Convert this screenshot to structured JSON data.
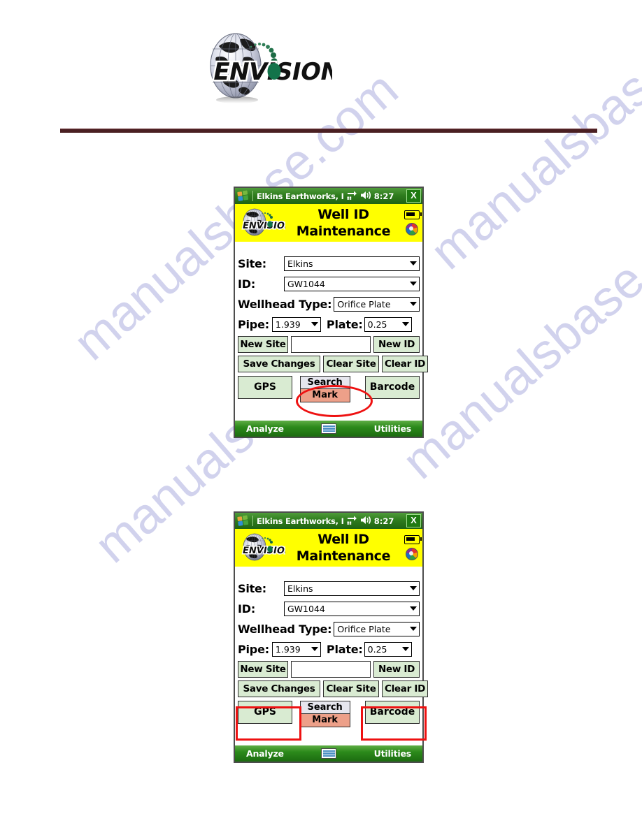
{
  "document": {
    "logo_text": "ENVISION",
    "logo_alt": "envision-globe-logo"
  },
  "screenshots": [
    {
      "id": "screenshot-top",
      "titlebar": {
        "start_icon": "windows-logo-icon",
        "app_title": "Elkins Earthworks, I",
        "network_icon": "network-connectivity-icon",
        "speaker_icon": "speaker-icon",
        "time": "8:27",
        "close_label": "X"
      },
      "header": {
        "brand": "ENVISION",
        "title_line1": "Well ID",
        "title_line2": "Maintenance",
        "battery_icon": "battery-icon",
        "wheel_icon": "color-wheel-icon"
      },
      "form": {
        "site_label": "Site:",
        "site_value": "Elkins",
        "id_label": "ID:",
        "id_value": "GW1044",
        "wellhead_label": "Wellhead Type:",
        "wellhead_value": "Orifice Plate",
        "pipe_label": "Pipe:",
        "pipe_value": "1.939",
        "plate_label": "Plate:",
        "plate_value": "0.25",
        "new_entry_value": ""
      },
      "buttons": {
        "new_site": "New Site",
        "new_id": "New ID",
        "save_changes": "Save Changes",
        "clear_site": "Clear Site",
        "clear_id": "Clear ID",
        "gps": "GPS",
        "search": "Search",
        "mark": "Mark",
        "barcode": "Barcode"
      },
      "bottombar": {
        "left": "Analyze",
        "keyboard_icon": "keyboard-icon",
        "right": "Utilities"
      },
      "annotation": {
        "type": "oval",
        "target": "mark-button",
        "color": "#ee1111"
      }
    },
    {
      "id": "screenshot-bottom",
      "titlebar": {
        "start_icon": "windows-logo-icon",
        "app_title": "Elkins Earthworks, I",
        "network_icon": "network-connectivity-icon",
        "speaker_icon": "speaker-icon",
        "time": "8:27",
        "close_label": "X"
      },
      "header": {
        "brand": "ENVISION",
        "title_line1": "Well ID",
        "title_line2": "Maintenance",
        "battery_icon": "battery-icon",
        "wheel_icon": "color-wheel-icon"
      },
      "form": {
        "site_label": "Site:",
        "site_value": "Elkins",
        "id_label": "ID:",
        "id_value": "GW1044",
        "wellhead_label": "Wellhead Type:",
        "wellhead_value": "Orifice Plate",
        "pipe_label": "Pipe:",
        "pipe_value": "1.939",
        "plate_label": "Plate:",
        "plate_value": "0.25",
        "new_entry_value": ""
      },
      "buttons": {
        "new_site": "New Site",
        "new_id": "New ID",
        "save_changes": "Save Changes",
        "clear_site": "Clear Site",
        "clear_id": "Clear ID",
        "gps": "GPS",
        "search": "Search",
        "mark": "Mark",
        "barcode": "Barcode"
      },
      "bottombar": {
        "left": "Analyze",
        "keyboard_icon": "keyboard-icon",
        "right": "Utilities"
      },
      "annotation": {
        "type": "rectangles",
        "targets": [
          "gps-button",
          "barcode-button"
        ],
        "color": "#ee1111"
      }
    }
  ],
  "watermark": {
    "text_a": "manualsbase.com",
    "text_b": "manualsbase.com",
    "text_c": "manualsbase.com",
    "text_d": "manualsbase.com"
  },
  "colors": {
    "header_yellow": "#ffff00",
    "titlebar_green": "#2f7d1e",
    "button_green": "#d9ebd2",
    "mark_salmon": "#eda089",
    "annotation_red": "#ee1111",
    "rule_maroon": "#4a1f22"
  }
}
